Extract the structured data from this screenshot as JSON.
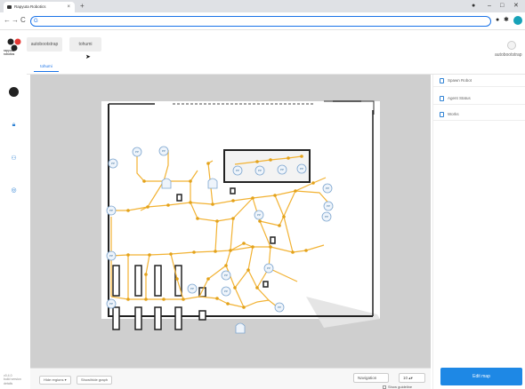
{
  "browser": {
    "tab_title": "Rapyuta Robotics",
    "tab_close": "×",
    "new_tab": "+",
    "address": "",
    "win_min": "–",
    "win_max": "□",
    "win_close": "✕",
    "back": "←",
    "forward": "→",
    "reload": "C"
  },
  "app": {
    "logo_text": "rapyuta robotics",
    "tabs": [
      "autobootstrap",
      "tohumi"
    ],
    "user_name": "autobootstrap",
    "subtab": "tohumi",
    "version": "v0.4.0\nbuild version\ndetails"
  },
  "map": {
    "node_labels": {
      "n1": "PP",
      "n2": "PP",
      "n3": "PP",
      "n4": "PP",
      "n5": "PP",
      "n6": "PP",
      "n7": "PP",
      "n8": "PP",
      "n9": "PP",
      "n10": "PP",
      "n11": "PP",
      "n12": "PP",
      "n13": "PP",
      "n14": "PP",
      "n15": "PP",
      "n16": "PP",
      "n17": "PP",
      "n18": "PP",
      "n19": "PP"
    }
  },
  "footer": {
    "hide_regions": "Hide regions",
    "show_graph": "Show/hide graph",
    "navigation": "Navigation",
    "show_guideline": "Show guideline",
    "zoom": "10"
  },
  "right_panel": {
    "items": [
      "Spawn Robot",
      "Agent Status",
      "Works"
    ],
    "edit_button": "Edit map"
  },
  "colors": {
    "accent": "#1e88e5",
    "path": "#f2b233",
    "node": "#e3a21a"
  }
}
